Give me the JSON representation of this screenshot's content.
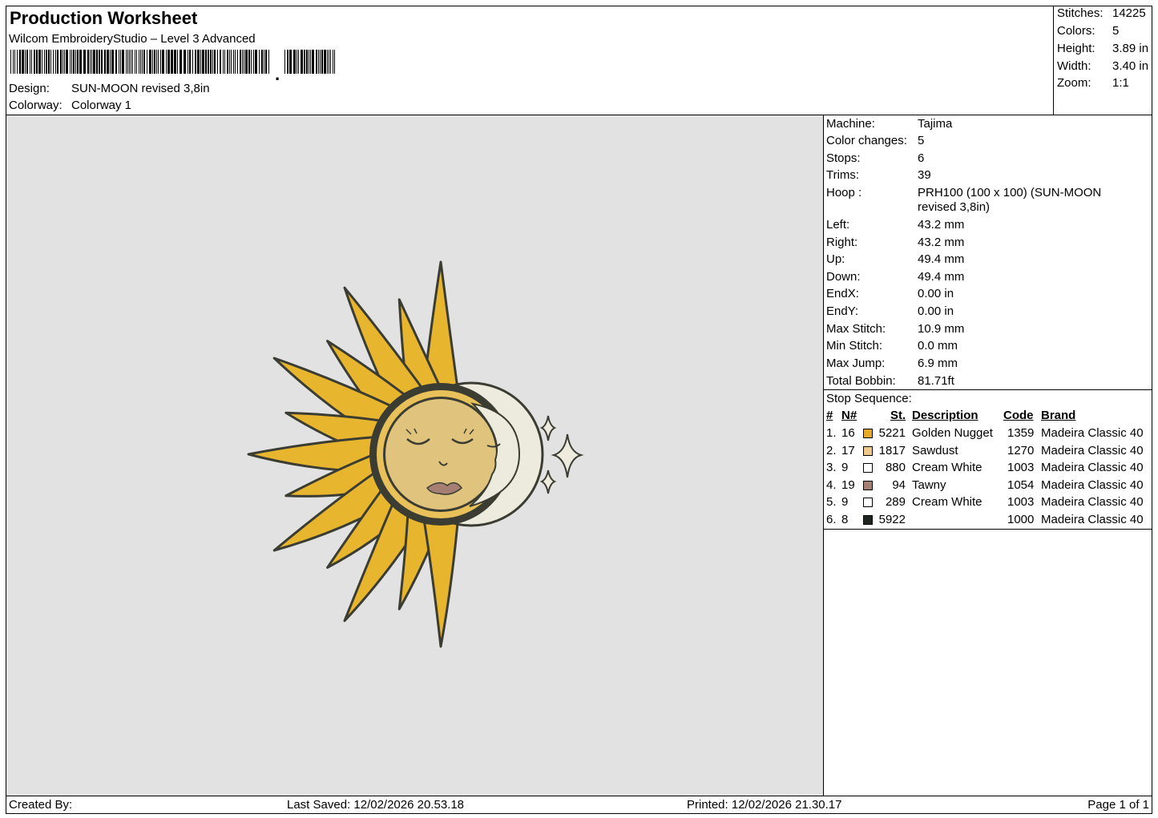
{
  "header": {
    "title": "Production Worksheet",
    "subtitle": "Wilcom EmbroideryStudio – Level 3 Advanced",
    "design_label": "Design:",
    "design_value": "SUN-MOON revised 3,8in",
    "colorway_label": "Colorway:",
    "colorway_value": "Colorway 1"
  },
  "stats": {
    "stitches_label": "Stitches:",
    "stitches_value": "14225",
    "colors_label": "Colors:",
    "colors_value": "5",
    "height_label": "Height:",
    "height_value": "3.89 in",
    "width_label": "Width:",
    "width_value": "3.40 in",
    "zoom_label": "Zoom:",
    "zoom_value": "1:1"
  },
  "info": {
    "machine": {
      "label": "Machine:",
      "value": "Tajima"
    },
    "color_changes": {
      "label": "Color changes:",
      "value": "5"
    },
    "stops": {
      "label": "Stops:",
      "value": "6"
    },
    "trims": {
      "label": "Trims:",
      "value": "39"
    },
    "hoop": {
      "label": "Hoop :",
      "value": "PRH100 (100 x 100) (SUN-MOON revised 3,8in)"
    },
    "left": {
      "label": "Left:",
      "value": "43.2 mm"
    },
    "right": {
      "label": "Right:",
      "value": "43.2 mm"
    },
    "up": {
      "label": "Up:",
      "value": "49.4 mm"
    },
    "down": {
      "label": "Down:",
      "value": "49.4 mm"
    },
    "endx": {
      "label": "EndX:",
      "value": "0.00 in"
    },
    "endy": {
      "label": "EndY:",
      "value": "0.00 in"
    },
    "max_stitch": {
      "label": "Max Stitch:",
      "value": "10.9 mm"
    },
    "min_stitch": {
      "label": "Min Stitch:",
      "value": "0.0 mm"
    },
    "max_jump": {
      "label": "Max Jump:",
      "value": "6.9 mm"
    },
    "total_bobbin": {
      "label": "Total Bobbin:",
      "value": "81.71ft"
    }
  },
  "sequence": {
    "title": "Stop Sequence:",
    "headers": {
      "num": "#",
      "n": "N#",
      "st": "St.",
      "desc": "Description",
      "code": "Code",
      "brand": "Brand"
    },
    "rows": [
      {
        "num": "1.",
        "n": "16",
        "color": "#e8a92a",
        "st": "5221",
        "desc": "Golden Nugget",
        "code": "1359",
        "brand": "Madeira Classic 40"
      },
      {
        "num": "2.",
        "n": "17",
        "color": "#efc98c",
        "st": "1817",
        "desc": "Sawdust",
        "code": "1270",
        "brand": "Madeira Classic 40"
      },
      {
        "num": "3.",
        "n": "9",
        "color": "#ffffff",
        "st": "880",
        "desc": "Cream White",
        "code": "1003",
        "brand": "Madeira Classic 40"
      },
      {
        "num": "4.",
        "n": "19",
        "color": "#a57f73",
        "st": "94",
        "desc": "Tawny",
        "code": "1054",
        "brand": "Madeira Classic 40"
      },
      {
        "num": "5.",
        "n": "9",
        "color": "#ffffff",
        "st": "289",
        "desc": "Cream White",
        "code": "1003",
        "brand": "Madeira Classic 40"
      },
      {
        "num": "6.",
        "n": "8",
        "color": "#1f2420",
        "st": "5922",
        "desc": "",
        "code": "1000",
        "brand": "Madeira Classic 40"
      }
    ]
  },
  "footer": {
    "created_by": "Created By:",
    "last_saved": "Last Saved: 12/02/2026 20.53.18",
    "printed": "Printed: 12/02/2026 21.30.17",
    "page": "Page 1 of 1"
  }
}
